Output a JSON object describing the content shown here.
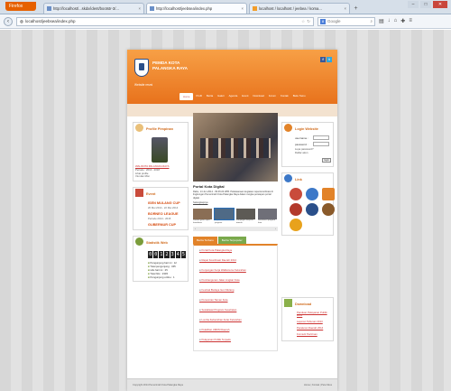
{
  "browser": {
    "menu_label": "Firefox",
    "tabs": [
      {
        "label": "http://localhost/...skdx/ident/bootstr-3/...",
        "active": false
      },
      {
        "label": "http://localhost/jeebsea/index.php",
        "active": true
      },
      {
        "label": "localhost / localhost / jeebea / koma...",
        "active": false
      }
    ],
    "new_tab": "+",
    "url": "localhost/jeebsea/index.php",
    "search_placeholder": "Google",
    "window_controls": [
      "–",
      "□",
      "✕"
    ]
  },
  "site": {
    "title_line1": "PEMDA KOTA",
    "title_line2": "PALANGKA RAYA",
    "subtitle": "Website resmi",
    "social": [
      "f",
      "t"
    ],
    "menu": [
      "Home",
      "Profil",
      "Berita",
      "Galeri",
      "Agenda",
      "Event",
      "Download",
      "Forum",
      "Kontak",
      "Buku Tamu"
    ],
    "left": {
      "profile_title": "Profile Pimpinan",
      "profile_name": "WALIKOTA PALANGKA RAYA",
      "profile_lines": [
        "Periode : 2013 - 2018",
        "Lihat profile",
        "Visi dan Misi"
      ],
      "event_title": "Event",
      "events": [
        {
          "name": "ISEN MULANG CUP",
          "date": "20 Mei 2014 - 22 Mei 2014"
        },
        {
          "name": "BORNEO LEAGUE",
          "date": "Periode 2014 - 2015"
        },
        {
          "name": "GUBERNUR CUP",
          "date": ""
        }
      ],
      "stats_title": "Statistik Web",
      "counter": [
        "0",
        "0",
        "1",
        "2",
        "3",
        "4",
        "5"
      ],
      "stats": [
        "Pengunjung hari ini : 12",
        "Total pengunjung : 345",
        "Hits hari ini : 25",
        "Total hits : 2345",
        "Pengunjung online : 1"
      ]
    },
    "center": {
      "news_title": "Portal Kota Digital",
      "news_text": "Rabu, 14 Jun 2014 - 09:45:24 WIB. Pelaksanaan kegiatan rapat koordinasi di lingkungan Pemerintah Kota Palangka Raya dalam rangka persiapan portal digital.",
      "read_more": "Selengkapnya",
      "thumbs": [
        {
          "caption": "Pemkot gelar rapat koordinasi"
        },
        {
          "caption": "Rapat evaluasi program"
        },
        {
          "caption": "Kunjungan kerja ke daerah"
        },
        {
          "caption": "Sosialisasi program kota"
        }
      ],
      "thumb_nav": [
        "‹",
        "›"
      ],
      "tabs": [
        "Berita Terbaru",
        "Berita Terpopuler"
      ],
      "list": [
        "Portal Kota Palangka Raya",
        "Rapat Koordinasi Daerah 2014",
        "Kunjungan Kerja Walikota ke Kelurahan",
        "Pembangunan Jalan Lingkar Kota",
        "Festival Budaya Isen Mulang",
        "Peresmian Taman Kota",
        "Sosialisasi Program Kesehatan",
        "Lomba Kebersihan Antar Kelurahan",
        "Pelatihan UMKM Daerah",
        "Pelayanan Publik Terpadu"
      ]
    },
    "right": {
      "login_title": "Login Website",
      "username_label": "username :",
      "password_label": "password :",
      "login_links": [
        "Lupa password?",
        "Daftar akun"
      ],
      "login_button": "login",
      "links_title": "Link",
      "download_title": "Download",
      "downloads": [
        "Panduan Pelayanan Publik 2014",
        "Laporan Tahunan 2013",
        "Peraturan Daerah 2014",
        "Formulir Perizinan"
      ]
    },
    "footer_left": "Copyright 2014 Pemerintah Kota Palangka Raya",
    "footer_right": "Home | Kontak | Peta Situs"
  }
}
